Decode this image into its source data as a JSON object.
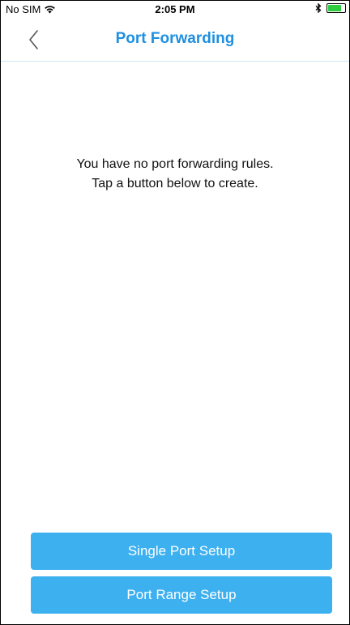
{
  "status_bar": {
    "carrier": "No SIM",
    "time": "2:05 PM",
    "battery_color": "#2ecc40"
  },
  "nav": {
    "title": "Port Forwarding",
    "back_icon": "chevron-left-icon",
    "title_color": "#1f8fe0"
  },
  "empty_state": {
    "line1": "You have no port forwarding rules.",
    "line2": "Tap a button below to create."
  },
  "buttons": {
    "single_port": "Single Port Setup",
    "port_range": "Port Range Setup",
    "color": "#3db0ef"
  }
}
